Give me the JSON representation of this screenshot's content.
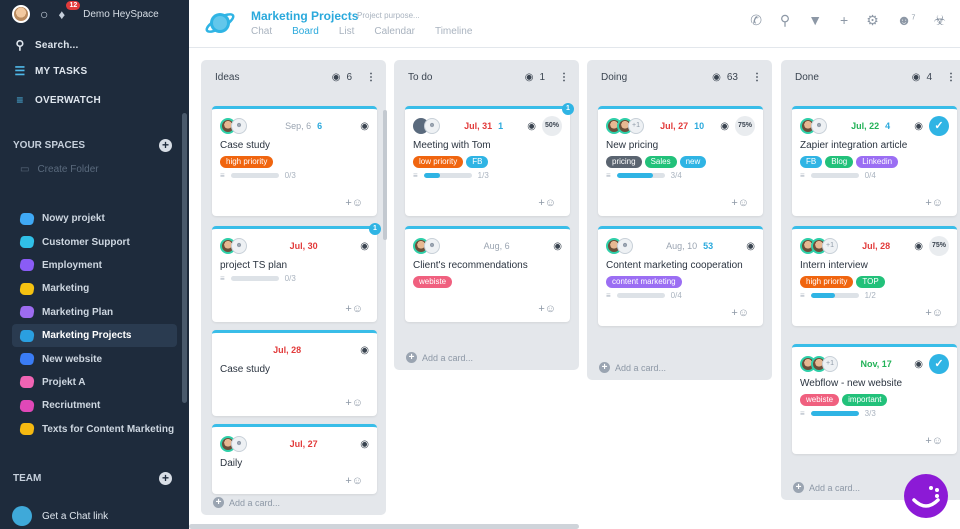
{
  "workspace": {
    "name": "Demo HeySpace",
    "notifications": "12"
  },
  "nav": {
    "search": "Search...",
    "my_tasks": "MY TASKS",
    "overwatch": "OVERWATCH"
  },
  "spaces": {
    "header": "YOUR SPACES",
    "create_folder": "Create Folder",
    "items": [
      {
        "label": "Nowy projekt",
        "color": "#3fa9f5"
      },
      {
        "label": "Customer Support",
        "color": "#30c0e8"
      },
      {
        "label": "Employment",
        "color": "#8a5cf6"
      },
      {
        "label": "Marketing",
        "color": "#f5c211"
      },
      {
        "label": "Marketing Plan",
        "color": "#9d6cf0"
      },
      {
        "label": "Marketing Projects",
        "color": "#2a9fe0"
      },
      {
        "label": "New website",
        "color": "#3a7cf5"
      },
      {
        "label": "Projekt A",
        "color": "#f064b4"
      },
      {
        "label": "Recriutment",
        "color": "#e048b8"
      },
      {
        "label": "Texts for Content Marketing",
        "color": "#f5b911"
      }
    ]
  },
  "team": {
    "header": "TEAM",
    "chat_link": "Get a Chat link"
  },
  "project": {
    "title": "Marketing Projects",
    "purpose_placeholder": "Project purpose...",
    "tabs": [
      "Chat",
      "Board",
      "List",
      "Calendar",
      "Timeline"
    ],
    "active_tab": "Board",
    "members_count": "7"
  },
  "columns": [
    {
      "name": "Ideas",
      "watch": "6",
      "add": "Add a card...",
      "cards": [
        {
          "date": "Sep, 6",
          "date_style": "grey",
          "num": "6",
          "title": "Case study",
          "tags": [
            {
              "t": "high priority",
              "c": "#f0650f"
            }
          ],
          "progress": "0/3",
          "fill": 0
        },
        {
          "date": "Jul, 30",
          "date_style": "red",
          "title": "project TS plan",
          "tags": [],
          "progress": "0/3",
          "fill": 0,
          "notif": "1"
        },
        {
          "date": "Jul, 28",
          "date_style": "red",
          "title": "Case study",
          "tags": [],
          "noav": true
        },
        {
          "date": "Jul, 27",
          "date_style": "red",
          "title": "Daily",
          "tags": []
        }
      ]
    },
    {
      "name": "To do",
      "watch": "1",
      "add": "Add a card...",
      "cards": [
        {
          "date": "Jul, 31",
          "date_style": "red",
          "num": "1",
          "pct": "50%",
          "title": "Meeting with Tom",
          "tags": [
            {
              "t": "low priority",
              "c": "#f0650f"
            },
            {
              "t": "FB",
              "c": "#2fb4e4"
            }
          ],
          "progress": "1/3",
          "fill": 0.33,
          "notif": "1",
          "avatar": "M"
        },
        {
          "date": "Aug, 6",
          "date_style": "grey",
          "title": "Client's recommendations",
          "tags": [
            {
              "t": "webiste",
              "c": "#f0607f"
            }
          ]
        }
      ]
    },
    {
      "name": "Doing",
      "watch": "63",
      "add": "Add a card...",
      "cards": [
        {
          "date": "Jul, 27",
          "date_style": "red",
          "num": "10",
          "pct": "75%",
          "plus": "+1",
          "title": "New pricing",
          "tags": [
            {
              "t": "pricing",
              "c": "#5a6470"
            },
            {
              "t": "Sales",
              "c": "#22c17a"
            },
            {
              "t": "new",
              "c": "#2fb4e4"
            }
          ],
          "progress": "3/4",
          "fill": 0.75
        },
        {
          "date": "Aug, 10",
          "date_style": "grey",
          "num": "53",
          "title": "Content marketing cooperation",
          "tags": [
            {
              "t": "content marketing",
              "c": "#9b6ef3"
            }
          ],
          "progress": "0/4",
          "fill": 0
        }
      ]
    },
    {
      "name": "Done",
      "watch": "4",
      "add": "Add a card...",
      "cards": [
        {
          "date": "Jul, 22",
          "date_style": "green",
          "num": "4",
          "check": true,
          "title": "Zapier integration article",
          "tags": [
            {
              "t": "FB",
              "c": "#2fb4e4"
            },
            {
              "t": "Blog",
              "c": "#22c17a"
            },
            {
              "t": "Linkedin",
              "c": "#9b6ef3"
            }
          ],
          "progress": "0/4",
          "fill": 0
        },
        {
          "date": "Jul, 28",
          "date_style": "red",
          "pct": "75%",
          "plus": "+1",
          "title": "Intern interview",
          "tags": [
            {
              "t": "high priority",
              "c": "#f0650f"
            },
            {
              "t": "TOP",
              "c": "#22c17a"
            }
          ],
          "progress": "1/2",
          "fill": 0.5
        },
        {
          "date": "Nov, 17",
          "date_style": "green",
          "check": true,
          "plus": "+1",
          "title": "Webflow - new website",
          "tags": [
            {
              "t": "webiste",
              "c": "#f0607f"
            },
            {
              "t": "important",
              "c": "#22c17a"
            }
          ],
          "progress": "3/3",
          "fill": 1
        }
      ]
    }
  ]
}
